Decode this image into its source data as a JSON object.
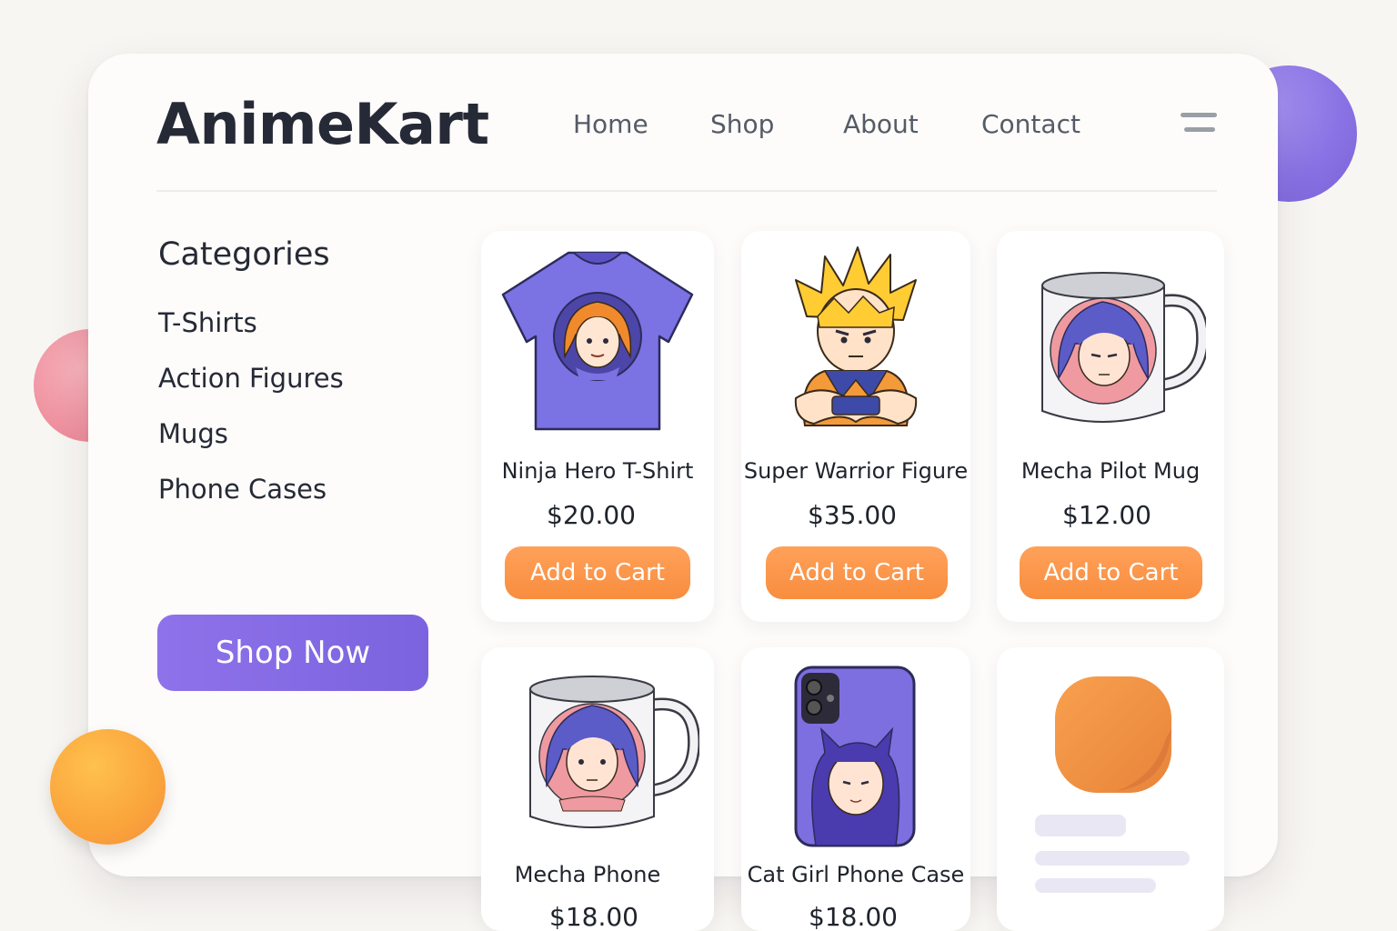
{
  "brand": {
    "name": "AnimeKart"
  },
  "nav": {
    "items": [
      "Home",
      "Shop",
      "About",
      "Contact"
    ],
    "menu_icon": "hamburger-menu-icon"
  },
  "sidebar": {
    "title": "Categories",
    "categories": [
      "T-Shirts",
      "Action Figures",
      "Mugs",
      "Phone Cases"
    ],
    "cta": "Shop Now"
  },
  "products": [
    {
      "name": "Ninja Hero T-Shirt",
      "price": "$20.00",
      "button": "Add to Cart",
      "icon": "tshirt-icon"
    },
    {
      "name": "Super Warrior Figure",
      "price": "$35.00",
      "button": "Add to Cart",
      "icon": "action-figure-icon"
    },
    {
      "name": "Mecha Pilot Mug",
      "price": "$12.00",
      "button": "Add to Cart",
      "icon": "mug-icon"
    },
    {
      "name": "Mecha Phone",
      "price": "$18.00",
      "icon": "mug-icon"
    },
    {
      "name": "Cat Girl Phone Case",
      "price": "$18.00",
      "icon": "phone-case-icon"
    },
    {
      "icon": "placeholder-image-icon",
      "loading": true
    }
  ],
  "colors": {
    "accent_purple": "#7b63df",
    "accent_orange": "#f88d3e",
    "text_dark": "#262a36",
    "background": "#f8f6f2"
  }
}
